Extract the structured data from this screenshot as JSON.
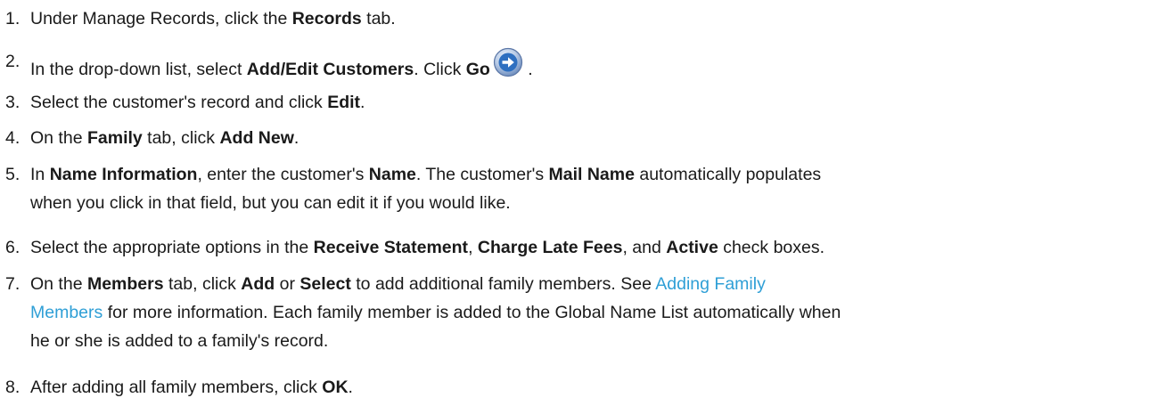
{
  "steps": [
    {
      "number": "1.",
      "parts": {
        "a": "Under Manage Records, click the ",
        "b": "Records",
        "c": " tab."
      }
    },
    {
      "number": "2.",
      "parts": {
        "a": "In the drop-down list, select ",
        "b": "Add/Edit Customers",
        "c": ". Click ",
        "d": "Go",
        "e": " ."
      },
      "icon": "go-arrow-icon"
    },
    {
      "number": "3.",
      "parts": {
        "a": "Select the customer's record and click ",
        "b": "Edit",
        "c": "."
      }
    },
    {
      "number": "4.",
      "parts": {
        "a": "On the ",
        "b": "Family",
        "c": " tab, click ",
        "d": "Add New",
        "e": "."
      }
    },
    {
      "number": "5.",
      "parts": {
        "a": "In ",
        "b": "Name Information",
        "c": ", enter the customer's ",
        "d": "Name",
        "e": ". The customer's ",
        "f": "Mail Name",
        "g": " automatically populates",
        "line2": "when you click in that field, but you can edit it if you would like."
      }
    },
    {
      "number": "6.",
      "parts": {
        "a": "Select the appropriate options in the ",
        "b": "Receive Statement",
        "c": ", ",
        "d": "Charge Late Fees",
        "e": ", and ",
        "f": "Active",
        "g": " check boxes."
      }
    },
    {
      "number": "7.",
      "parts": {
        "a": "On the ",
        "b": "Members",
        "c": " tab, click ",
        "d": "Add",
        "e": " or ",
        "f": "Select",
        "g": " to add additional family members. See ",
        "link1": "Adding Family",
        "link2": "Members",
        "h": " for more information. Each family member is added to the Global Name List automatically when",
        "line3": "he or she is added to a family's record."
      }
    },
    {
      "number": "8.",
      "parts": {
        "a": "After adding all family members, click ",
        "b": "OK",
        "c": "."
      }
    }
  ],
  "colors": {
    "text": "#1a1a1a",
    "link": "#2f9fd6",
    "go_icon_blue": "#2e6fc0"
  }
}
